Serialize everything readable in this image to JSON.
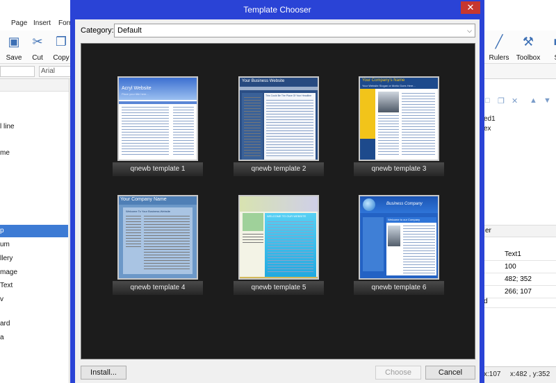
{
  "app": {
    "menu": [
      "Page",
      "Insert",
      "Forr"
    ],
    "ribbon_left": [
      "Save",
      "Cut",
      "Copy"
    ],
    "ribbon_right": [
      "Rulers",
      "Toolbox",
      "Si"
    ],
    "font_name": "Arial",
    "left_tools": [
      "l line",
      "me",
      "p",
      "um",
      "llery",
      "mage",
      "Text",
      "v",
      "ard",
      "a"
    ],
    "right_lines": [
      "ed1",
      "ex"
    ],
    "properties_header": "er",
    "properties": [
      {
        "name": "",
        "value": "Text1"
      },
      {
        "name": "",
        "value": "100"
      },
      {
        "name": "",
        "value": "482; 352"
      },
      {
        "name": "",
        "value": "266; 107"
      },
      {
        "name": "d",
        "value": ""
      }
    ],
    "status": {
      "size": "x:107",
      "position": "x:482 , y:352"
    }
  },
  "dialog": {
    "title": "Template Chooser",
    "close_glyph": "✕",
    "category_label": "Category:",
    "category_value": "Default",
    "templates": [
      {
        "name": "qnewb template 1",
        "heading": "Acryl Website",
        "tagline": "Place your title here..."
      },
      {
        "name": "qnewb template 2",
        "heading": "Your Business Website",
        "tagline": "This Could Be The Place Of Your Headline"
      },
      {
        "name": "qnewb template 3",
        "heading": "Your Company's Name",
        "tagline": "Your Website Slogan or Motto Goes Here..."
      },
      {
        "name": "qnewb template 4",
        "heading": "Your Company Name",
        "tagline": "Welcome To Your Business-Website"
      },
      {
        "name": "qnewb template 5",
        "heading": "WELCOME TO OUR WEBSITE",
        "tagline": ""
      },
      {
        "name": "qnewb template 6",
        "heading": "Business Company",
        "tagline": "Welcome to our Company"
      }
    ],
    "install_label": "Install...",
    "choose_label": "Choose",
    "cancel_label": "Cancel"
  },
  "colors": {
    "dialog_frame": "#2a43d6",
    "gallery_bg": "#1c1c1c",
    "selection": "#3d7bd4",
    "close": "#c7372f"
  }
}
